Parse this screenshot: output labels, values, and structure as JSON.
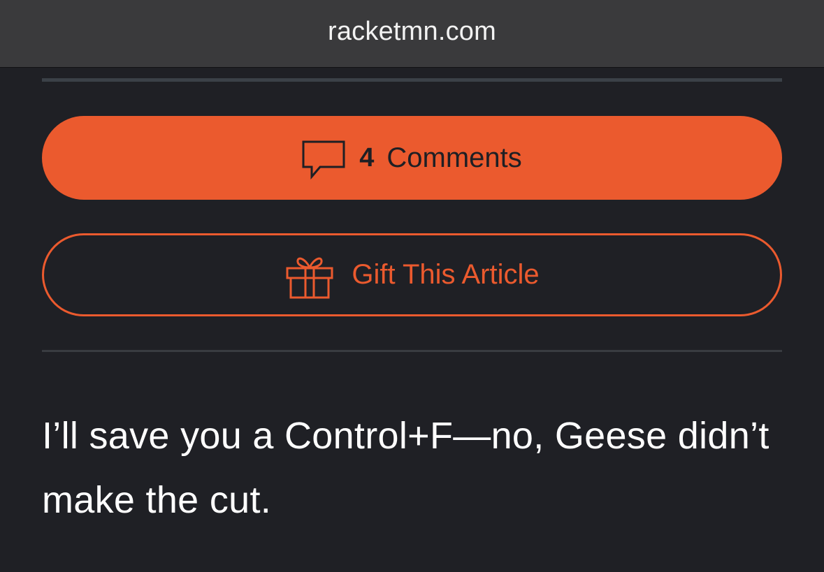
{
  "browser": {
    "url": "racketmn.com"
  },
  "article_actions": {
    "comments": {
      "count": "4",
      "label": "Comments",
      "icon": "speech-bubble-icon"
    },
    "gift": {
      "label": "Gift This Article",
      "icon": "gift-icon"
    }
  },
  "article": {
    "paragraph": "I’ll save you a Control+F—no, Geese didn’t make the cut."
  },
  "colors": {
    "accent": "#eb5a2e",
    "background": "#1f2025",
    "address_bar": "#3a3a3c"
  }
}
